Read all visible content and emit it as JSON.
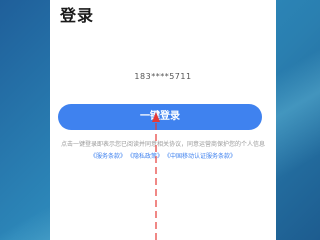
{
  "header": {
    "title": "登录"
  },
  "phone": {
    "masked_number": "183****5711"
  },
  "login": {
    "button_label": "一键登录"
  },
  "agreement": {
    "text": "点击一键登录即表示您已阅读并同意相关协议，同意运营商保护您的个人信息",
    "links": [
      "《服务条款》",
      "《隐私政策》",
      "《中国移动认证服务条款》"
    ]
  },
  "colors": {
    "accent": "#3f82ef",
    "background": "#2a7fb0"
  }
}
